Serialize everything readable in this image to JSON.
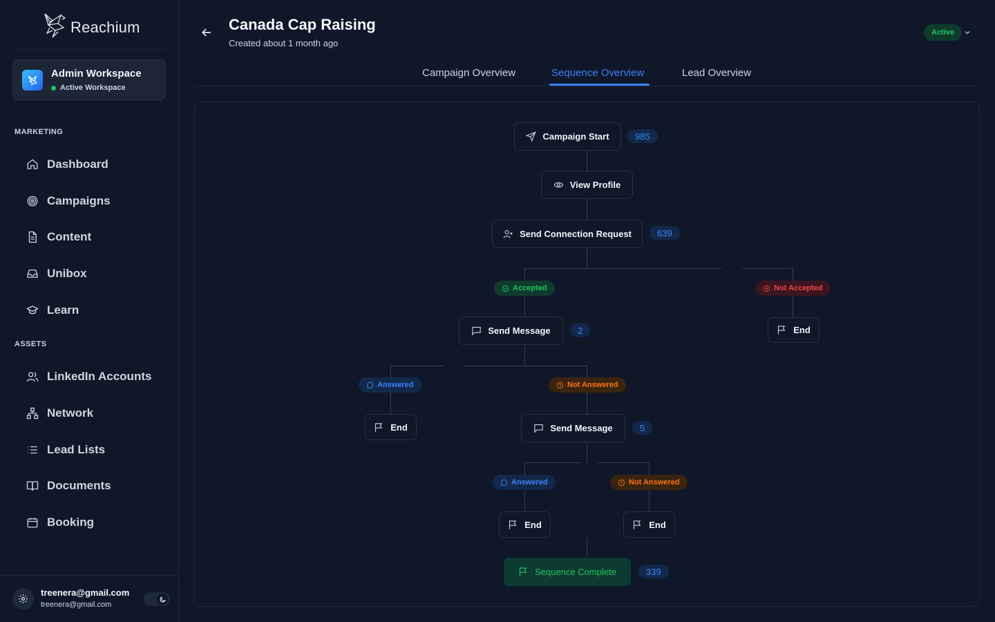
{
  "brand": {
    "name": "Reachium"
  },
  "workspace": {
    "title": "Admin Workspace",
    "status": "Active Workspace"
  },
  "sidebar": {
    "sections": [
      {
        "label": "MARKETING",
        "items": [
          {
            "label": "Dashboard",
            "icon": "home-icon"
          },
          {
            "label": "Campaigns",
            "icon": "target-icon"
          },
          {
            "label": "Content",
            "icon": "document-icon"
          },
          {
            "label": "Unibox",
            "icon": "inbox-icon"
          },
          {
            "label": "Learn",
            "icon": "graduation-cap-icon"
          }
        ]
      },
      {
        "label": "ASSETS",
        "items": [
          {
            "label": "LinkedIn Accounts",
            "icon": "users-icon"
          },
          {
            "label": "Network",
            "icon": "network-icon"
          },
          {
            "label": "Lead Lists",
            "icon": "list-icon"
          },
          {
            "label": "Documents",
            "icon": "book-icon"
          },
          {
            "label": "Booking",
            "icon": "calendar-icon"
          }
        ]
      }
    ]
  },
  "user": {
    "email": "treenera@gmail.com",
    "email_secondary": "treenera@gmail.com"
  },
  "header": {
    "title": "Canada Cap Raising",
    "subtitle": "Created about 1 month ago",
    "status": "Active"
  },
  "tabs": [
    {
      "label": "Campaign Overview",
      "active": false
    },
    {
      "label": "Sequence Overview",
      "active": true
    },
    {
      "label": "Lead Overview",
      "active": false
    }
  ],
  "flow": {
    "campaign_start": {
      "label": "Campaign Start",
      "count": "985"
    },
    "view_profile": {
      "label": "View Profile"
    },
    "connection_request": {
      "label": "Send Connection Request",
      "count": "639"
    },
    "accepted": "Accepted",
    "not_accepted": "Not Accepted",
    "end_not_accepted": "End",
    "send_message_1": {
      "label": "Send Message",
      "count": "2"
    },
    "answered_1": "Answered",
    "not_answered_1": "Not Answered",
    "end_answered_1": "End",
    "send_message_2": {
      "label": "Send Message",
      "count": "5"
    },
    "answered_2": "Answered",
    "not_answered_2": "Not Answered",
    "end_answered_2": "End",
    "end_not_answered_2": "End",
    "sequence_complete": {
      "label": "Sequence Complete",
      "count": "339"
    }
  },
  "colors": {
    "accent": "#3b82f6",
    "success": "#22c55e",
    "danger": "#ef4444",
    "warning": "#f97316",
    "background": "#0f1729"
  }
}
